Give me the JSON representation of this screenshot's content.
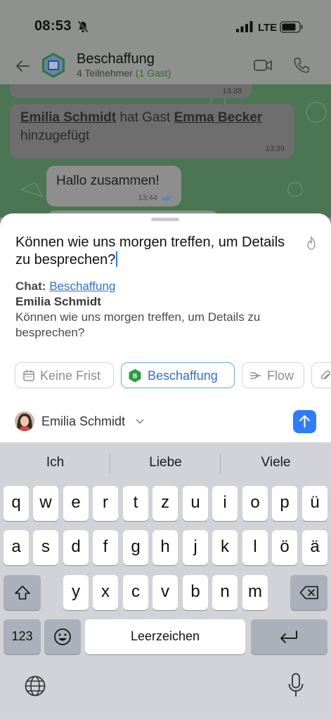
{
  "status_bar": {
    "time": "08:53",
    "network": "LTE"
  },
  "chat": {
    "title": "Beschaffung",
    "participants": "4 Teilnehmer",
    "guests": "(1 Gast)",
    "messages": [
      {
        "time": "13:38"
      },
      {
        "actor": "Emilia Schmidt",
        "action": "hat Gast",
        "target": "Emma Becker",
        "suffix": "hinzugefügt",
        "time": "13:39"
      },
      {
        "text": "Hallo zusammen!",
        "time": "13:44"
      }
    ]
  },
  "task_sheet": {
    "text": "Können wie uns morgen treffen, um Details zu besprechen?",
    "chat_label": "Chat:",
    "chat_name": "Beschaffung",
    "author": "Emilia Schmidt",
    "quote": "Können wie uns morgen treffen, um Details zu besprechen?",
    "chips": {
      "deadline": "Keine Frist",
      "chat": "Beschaffung",
      "flow": "Flow"
    },
    "assignee": "Emilia Schmidt"
  },
  "keyboard": {
    "suggestions": [
      "Ich",
      "Liebe",
      "Viele"
    ],
    "row1": [
      "q",
      "w",
      "e",
      "r",
      "t",
      "z",
      "u",
      "i",
      "o",
      "p",
      "ü"
    ],
    "row2": [
      "a",
      "s",
      "d",
      "f",
      "g",
      "h",
      "j",
      "k",
      "l",
      "ö",
      "ä"
    ],
    "row3": [
      "y",
      "x",
      "c",
      "v",
      "b",
      "n",
      "m"
    ],
    "numbers_label": "123",
    "space_label": "Leerzeichen"
  },
  "colors": {
    "accent": "#2f7cf6",
    "chat_bg": "#4c7553",
    "link": "#2e6fcf",
    "guest_green": "#2f6e2d"
  },
  "icons": [
    "bell-muted-icon",
    "signal-icon",
    "battery-icon",
    "back-arrow-icon",
    "group-avatar",
    "video-icon",
    "phone-icon",
    "flame-icon",
    "calendar-icon",
    "chat-badge-icon",
    "flow-icon",
    "paperclip-icon",
    "chevron-down-icon",
    "send-arrow-icon",
    "shift-icon",
    "backspace-icon",
    "emoji-icon",
    "return-icon",
    "globe-icon",
    "mic-icon"
  ]
}
